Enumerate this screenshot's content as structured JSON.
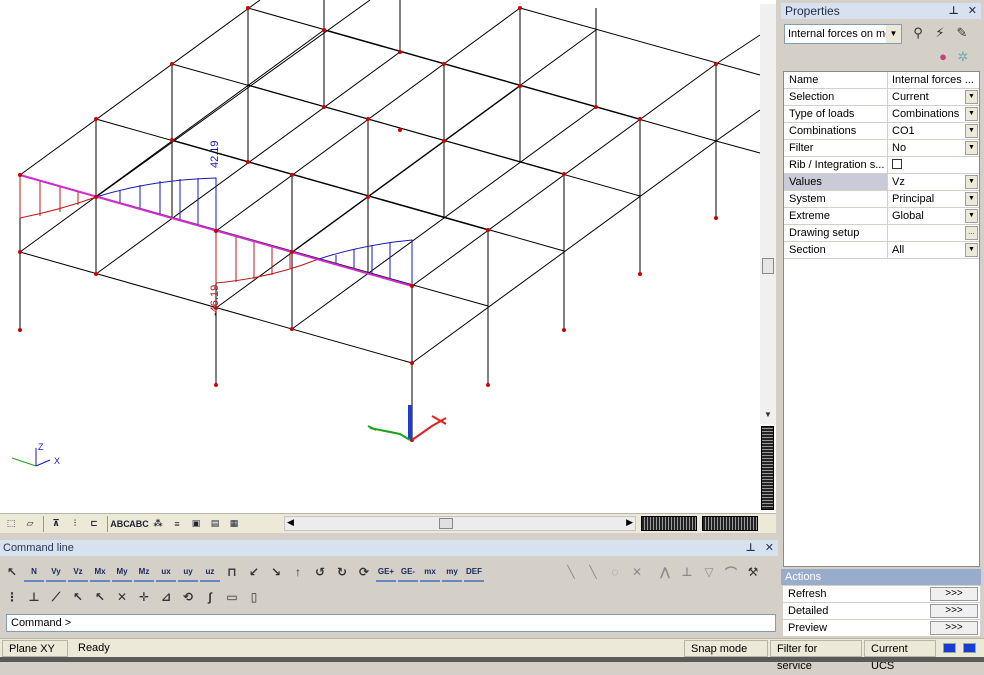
{
  "properties": {
    "title": "Properties",
    "selector_value": "Internal forces on me",
    "rows": [
      {
        "key": "Name",
        "value": "Internal forces ..."
      },
      {
        "key": "Selection",
        "value": "Current"
      },
      {
        "key": "Type of loads",
        "value": "Combinations"
      },
      {
        "key": "Combinations",
        "value": "CO1"
      },
      {
        "key": "Filter",
        "value": "No"
      },
      {
        "key": "Rib / Integration s...",
        "value": ""
      },
      {
        "key": "Values",
        "value": "Vz"
      },
      {
        "key": "System",
        "value": "Principal"
      },
      {
        "key": "Extreme",
        "value": "Global"
      },
      {
        "key": "Drawing setup",
        "value": ""
      },
      {
        "key": "Section",
        "value": "All"
      }
    ],
    "actions_title": "Actions",
    "actions": [
      {
        "label": "Refresh",
        "button": ">>>"
      },
      {
        "label": "Detailed",
        "button": ">>>"
      },
      {
        "label": "Preview",
        "button": ">>>"
      }
    ]
  },
  "model": {
    "label_top": "42.19",
    "label_bottom": "-46.19",
    "axis_z": "Z",
    "axis_x": "X"
  },
  "command_line": {
    "title": "Command line",
    "prompt": "Command >",
    "toolbar_row1": [
      "N",
      "Vy",
      "Vz",
      "Mx",
      "My",
      "Mz",
      "ux",
      "uy",
      "uz"
    ],
    "toolbar_row1b": [
      "GE+",
      "GE-",
      "mx",
      "my",
      "DEF"
    ]
  },
  "view_toolbar": [
    "ABC",
    "ABC"
  ],
  "status": {
    "plane": "Plane XY",
    "state": "Ready",
    "snap": "Snap mode",
    "filter": "Filter for service",
    "ucs": "Current UCS"
  },
  "colors": {
    "frame": "#000000",
    "positive_diagram": "#1a1ab4",
    "negative_diagram": "#c01818",
    "beam_highlight": "#d02ad0",
    "node": "#cc0000",
    "panel_header": "#d7e1f0",
    "actions_header": "#9aaccb"
  }
}
